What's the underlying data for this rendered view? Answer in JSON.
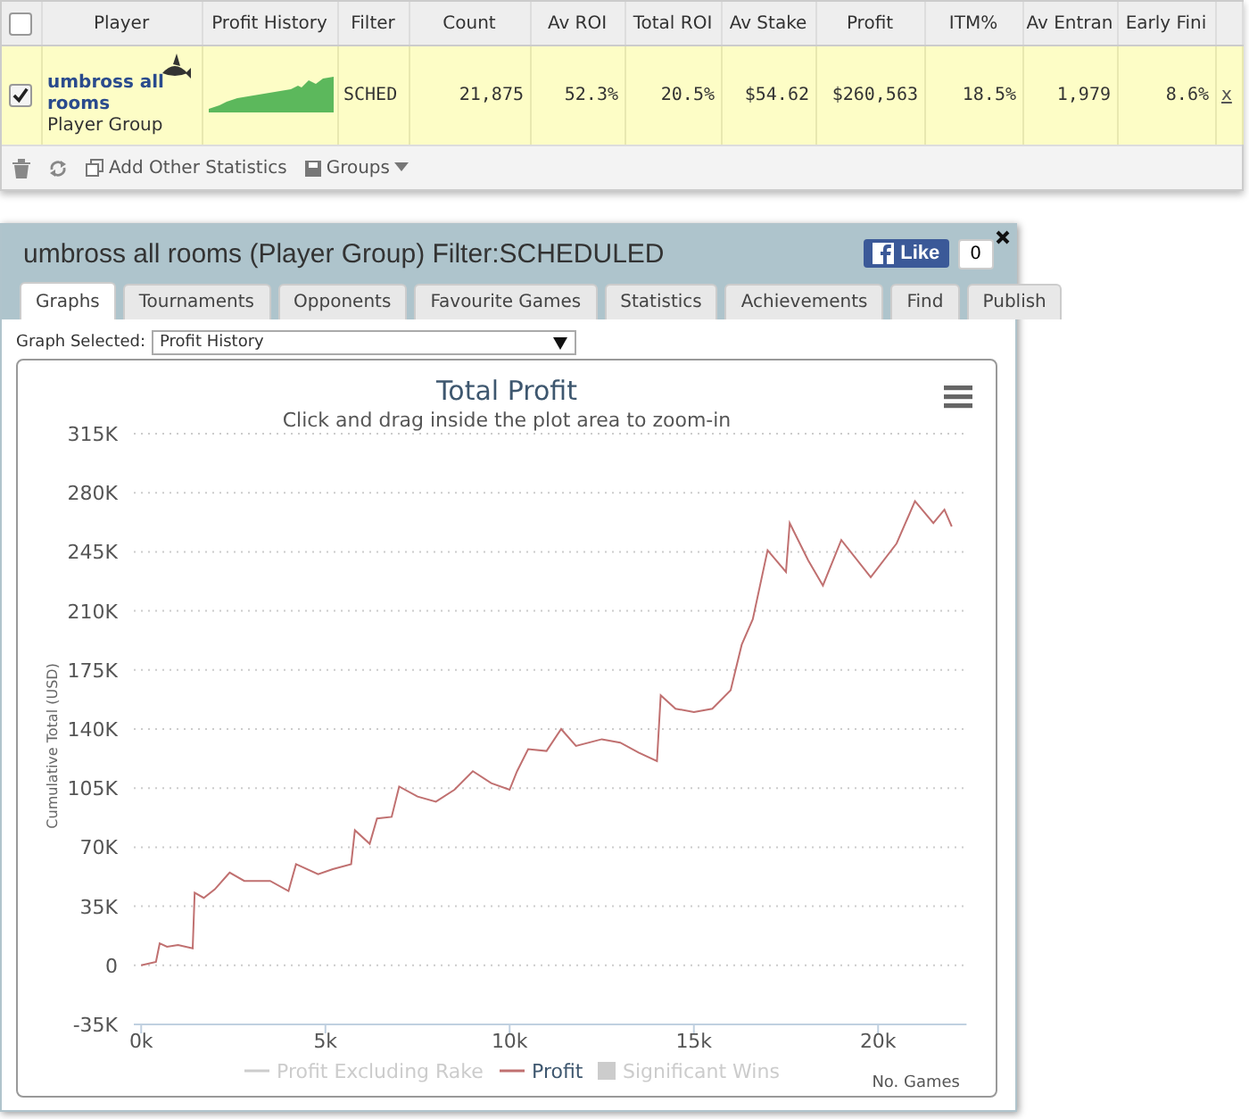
{
  "table": {
    "header_checkbox": {
      "checked": false
    },
    "columns": [
      "Player",
      "Profit History",
      "Filter",
      "Count",
      "Av ROI",
      "Total ROI",
      "Av Stake",
      "Profit",
      "ITM%",
      "Av Entran",
      "Early Fini"
    ],
    "rows": [
      {
        "checked": true,
        "player": "umbross all rooms",
        "group": "Player Group",
        "filter": "SCHED",
        "count": "21,875",
        "av_roi": "52.3%",
        "total_roi": "20.5%",
        "av_stake": "$54.62",
        "profit": "$260,563",
        "itm": "18.5%",
        "av_entrants": "1,979",
        "early_finish": "8.6%",
        "remove": "x"
      }
    ]
  },
  "toolbar": {
    "add_stats": "Add Other Statistics",
    "groups": "Groups"
  },
  "panel": {
    "title": "umbross all rooms (Player Group) Filter:SCHEDULED",
    "like": "Like",
    "like_count": "0",
    "tabs": [
      {
        "label": "Graphs",
        "selected": true
      },
      {
        "label": "Tournaments",
        "selected": false
      },
      {
        "label": "Opponents",
        "selected": false
      },
      {
        "label": "Favourite Games",
        "selected": false
      },
      {
        "label": "Statistics",
        "selected": false
      },
      {
        "label": "Achievements",
        "selected": false
      },
      {
        "label": "Find",
        "selected": false
      },
      {
        "label": "Publish",
        "selected": false
      }
    ],
    "graph_label": "Graph Selected:",
    "graph_value": "Profit History",
    "chart_data": {
      "type": "line",
      "title": "Total Profit",
      "subtitle": "Click and drag inside the plot area to zoom-in",
      "xlabel": "No. Games",
      "ylabel": "Cumulative Total (USD)",
      "x": [
        0,
        0.4,
        0.5,
        0.7,
        1.0,
        1.4,
        1.45,
        1.7,
        2.0,
        2.4,
        2.8,
        3.5,
        4.0,
        4.2,
        4.8,
        5.2,
        5.7,
        5.8,
        6.2,
        6.4,
        6.8,
        7.0,
        7.5,
        8.0,
        8.5,
        9.0,
        9.5,
        10.0,
        10.2,
        10.5,
        11.0,
        11.4,
        11.8,
        12.5,
        13.0,
        13.5,
        14.0,
        14.1,
        14.5,
        15.0,
        15.5,
        16.0,
        16.3,
        16.6,
        17.0,
        17.5,
        17.6,
        18.1,
        18.5,
        19.0,
        19.8,
        20.5,
        21.0,
        21.5,
        21.8,
        22.0
      ],
      "series": [
        {
          "name": "Profit",
          "color": "#c07070",
          "values": [
            0,
            2,
            13,
            11,
            12,
            10,
            43,
            40,
            45,
            55,
            50,
            50,
            44,
            60,
            54,
            57,
            60,
            80,
            72,
            87,
            88,
            106,
            100,
            97,
            104,
            115,
            108,
            104,
            115,
            128,
            127,
            140,
            130,
            134,
            132,
            126,
            121,
            160,
            152,
            150,
            152,
            163,
            190,
            205,
            246,
            233,
            262,
            240,
            225,
            252,
            230,
            250,
            275,
            262,
            270,
            260
          ]
        }
      ],
      "xlim": [
        -0.2,
        22.4
      ],
      "grid": true,
      "ylim": [
        -35,
        315
      ],
      "xticks": [
        {
          "value": 0,
          "label": "0k"
        },
        {
          "value": 5,
          "label": "5k"
        },
        {
          "value": 10,
          "label": "10k"
        },
        {
          "value": 15,
          "label": "15k"
        },
        {
          "value": 20,
          "label": "20k"
        }
      ],
      "yticks": [
        {
          "value": -35,
          "label": "-35K"
        },
        {
          "value": 0,
          "label": "0"
        },
        {
          "value": 35,
          "label": "35K"
        },
        {
          "value": 70,
          "label": "70K"
        },
        {
          "value": 105,
          "label": "105K"
        },
        {
          "value": 140,
          "label": "140K"
        },
        {
          "value": 175,
          "label": "175K"
        },
        {
          "value": 210,
          "label": "210K"
        },
        {
          "value": 245,
          "label": "245K"
        },
        {
          "value": 280,
          "label": "280K"
        },
        {
          "value": 315,
          "label": "315K"
        }
      ]
    },
    "legend": [
      {
        "label": "Profit Excluding Rake",
        "kind": "line",
        "visible": false
      },
      {
        "label": "Significant Wins",
        "kind": "box",
        "visible": false
      }
    ]
  }
}
